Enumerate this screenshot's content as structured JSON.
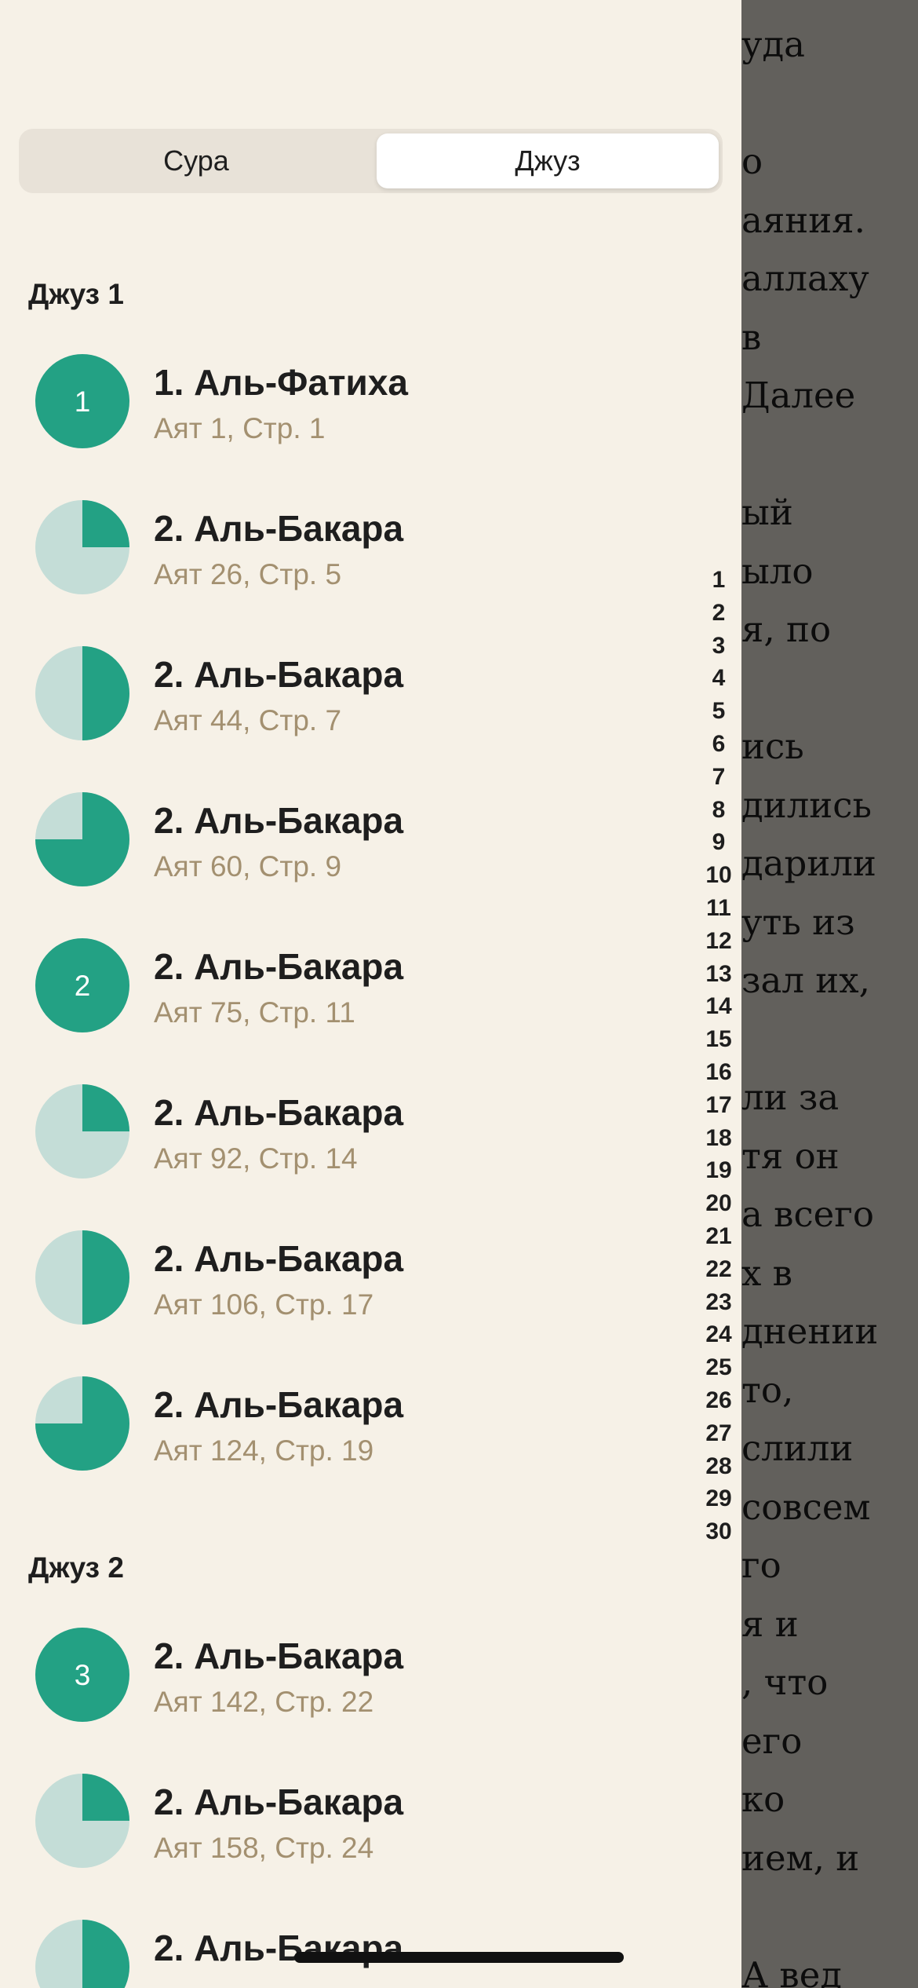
{
  "colors": {
    "accent": "#23a184",
    "accent_light": "#c4ddd7",
    "background": "#f6f1e7",
    "subtitle": "#a39070"
  },
  "segmented": {
    "surah_label": "Сура",
    "juz_label": "Джуз",
    "selected": "Джуз"
  },
  "sections": [
    {
      "title": "Джуз 1",
      "items": [
        {
          "title": "1. Аль-Фатиха",
          "subtitle": "Аят 1, Стр. 1",
          "badge": "1",
          "fill": 1.0
        },
        {
          "title": "2. Аль-Бакара",
          "subtitle": "Аят 26, Стр. 5",
          "badge": "",
          "fill": 0.25
        },
        {
          "title": "2. Аль-Бакара",
          "subtitle": "Аят 44, Стр. 7",
          "badge": "",
          "fill": 0.5
        },
        {
          "title": "2. Аль-Бакара",
          "subtitle": "Аят 60, Стр. 9",
          "badge": "",
          "fill": 0.75
        },
        {
          "title": "2. Аль-Бакара",
          "subtitle": "Аят 75, Стр. 11",
          "badge": "2",
          "fill": 1.0
        },
        {
          "title": "2. Аль-Бакара",
          "subtitle": "Аят 92, Стр. 14",
          "badge": "",
          "fill": 0.25
        },
        {
          "title": "2. Аль-Бакара",
          "subtitle": "Аят 106, Стр. 17",
          "badge": "",
          "fill": 0.5
        },
        {
          "title": "2. Аль-Бакара",
          "subtitle": "Аят 124, Стр. 19",
          "badge": "",
          "fill": 0.75
        }
      ]
    },
    {
      "title": "Джуз 2",
      "items": [
        {
          "title": "2. Аль-Бакара",
          "subtitle": "Аят 142, Стр. 22",
          "badge": "3",
          "fill": 1.0
        },
        {
          "title": "2. Аль-Бакара",
          "subtitle": "Аят 158, Стр. 24",
          "badge": "",
          "fill": 0.25
        },
        {
          "title": "2. Аль-Бакара",
          "subtitle": "",
          "badge": "",
          "fill": 0.5
        }
      ]
    }
  ],
  "index": [
    "1",
    "2",
    "3",
    "4",
    "5",
    "6",
    "7",
    "8",
    "9",
    "10",
    "11",
    "12",
    "13",
    "14",
    "15",
    "16",
    "17",
    "18",
    "19",
    "20",
    "21",
    "22",
    "23",
    "24",
    "25",
    "26",
    "27",
    "28",
    "29",
    "30"
  ],
  "reader_lines": [
    "уда",
    "",
    "о",
    "аяния.",
    "аллаху",
    "в",
    "Далее",
    "",
    "ый",
    "ыло",
    "я, по",
    "",
    "ись",
    "дились",
    "дарили",
    "уть из",
    "зал их,",
    "",
    "ли за",
    "тя он",
    "а всего",
    "х в",
    "днении",
    "то,",
    "слили",
    "совсем",
    "го",
    "я и",
    ", что",
    "его",
    "ко",
    "ием, и",
    "",
    "А вед"
  ]
}
